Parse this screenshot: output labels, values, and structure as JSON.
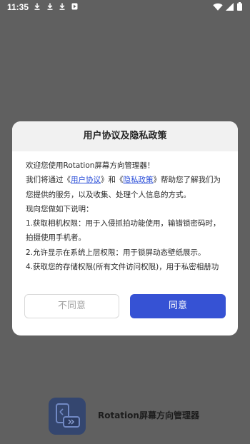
{
  "status_bar": {
    "time": "11:35",
    "left_icons": [
      "download-icon",
      "download-icon",
      "download-icon",
      "notification-icon"
    ],
    "right_icons": [
      "wifi-icon",
      "cellular-signal-icon",
      "battery-icon"
    ]
  },
  "dialog": {
    "title": "用户协议及隐私政策",
    "lines": [
      {
        "text": "欢迎您使用Rotation屏幕方向管理器！"
      },
      {
        "before": "我们将通过《",
        "link1": "用户协议",
        "middle": "》和《",
        "link2": "隐私政策",
        "after": "》帮助您了解我们为"
      },
      {
        "text": "您提供的服务，以及收集、处理个人信息的方式。"
      },
      {
        "text": "现向您做如下说明："
      },
      {
        "text": "1.获取相机权限：用于入侵抓拍功能使用，输错锁密码时，"
      },
      {
        "text": "拍摄使用手机者。"
      },
      {
        "text": "2.允许显示在系统上层权限：用于锁屏动态壁纸展示。"
      },
      {
        "text": "4.获取您的存储权限(所有文件访问权限)，用于私密相册功"
      }
    ],
    "decline_button": "不同意",
    "accept_button": "同意",
    "link_color": "#2f52d9",
    "accept_color": "#3652d4"
  },
  "background_app": {
    "name": "Rotation屏幕方向管理器",
    "icon": "rotation-app-icon"
  },
  "colors": {
    "scrim": "#606060",
    "dialog_header": "#f1f1f1"
  }
}
